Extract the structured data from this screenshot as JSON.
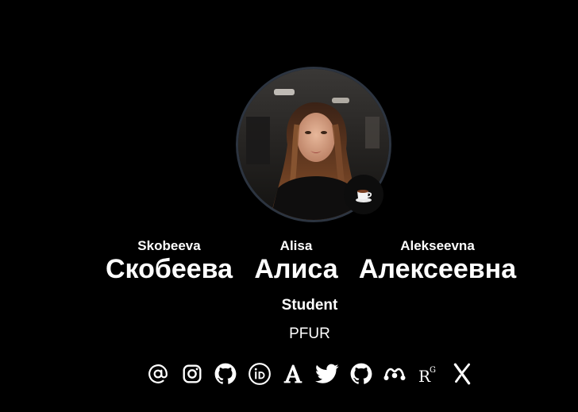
{
  "profile": {
    "name_latin": {
      "last": "Skobeeva",
      "first": "Alisa",
      "middle": "Alekseevna"
    },
    "name_ru": {
      "last": "Скобеева",
      "first": "Алиса",
      "middle": "Алексеевна"
    },
    "role": "Student",
    "organization": "PFUR",
    "status_icon": "coffee-cup-icon"
  },
  "socials": [
    {
      "name": "email",
      "icon": "at-sign-icon"
    },
    {
      "name": "instagram",
      "icon": "instagram-icon"
    },
    {
      "name": "github",
      "icon": "github-icon"
    },
    {
      "name": "orcid",
      "icon": "orcid-icon"
    },
    {
      "name": "academia",
      "icon": "academia-icon"
    },
    {
      "name": "twitter",
      "icon": "twitter-icon"
    },
    {
      "name": "github-2",
      "icon": "github-icon"
    },
    {
      "name": "mendeley",
      "icon": "mendeley-icon"
    },
    {
      "name": "researchgate",
      "icon": "researchgate-icon"
    },
    {
      "name": "arxiv",
      "icon": "arxiv-icon"
    }
  ],
  "colors": {
    "background": "#000000",
    "text": "#ffffff",
    "avatar_border": "#2c3440"
  }
}
